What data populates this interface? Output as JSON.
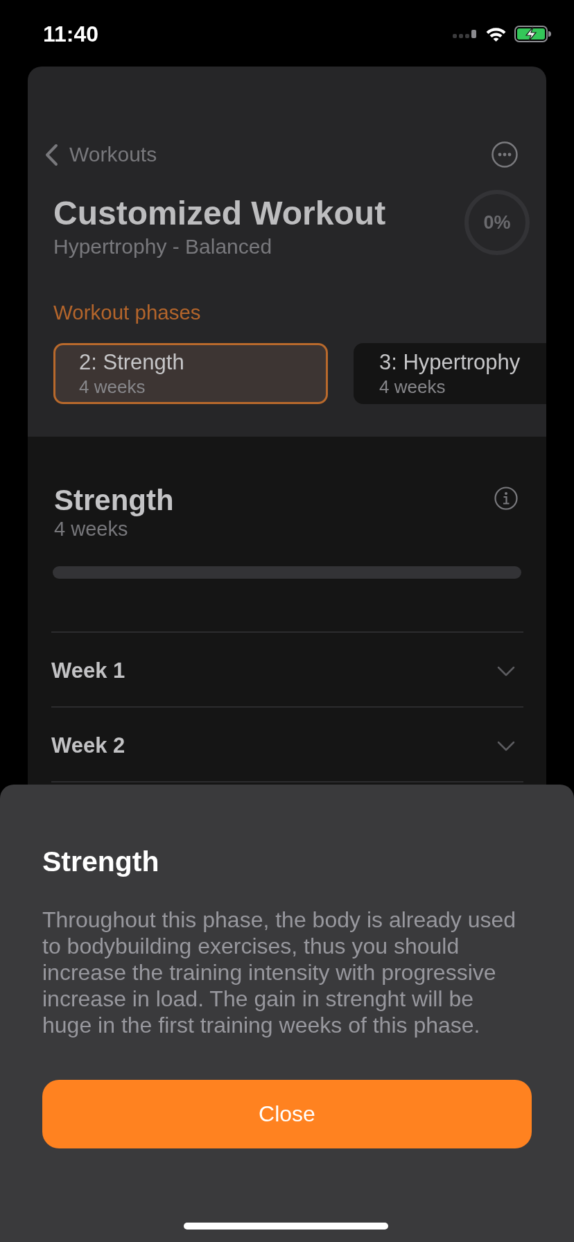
{
  "status_bar": {
    "time": "11:40"
  },
  "navigation": {
    "back_label": "Workouts"
  },
  "workout": {
    "title": "Customized Workout",
    "subtitle": "Hypertrophy - Balanced",
    "progress": "0%"
  },
  "phases": {
    "heading": "Workout phases",
    "items": [
      {
        "name": "2: Strength",
        "duration": "4 weeks",
        "selected": true
      },
      {
        "name": "3: Hypertrophy",
        "duration": "4 weeks",
        "selected": false
      }
    ]
  },
  "phase_detail": {
    "title": "Strength",
    "duration": "4 weeks",
    "level": 0
  },
  "weeks": [
    {
      "label": "Week 1",
      "expanded": false
    },
    {
      "label": "Week 2",
      "expanded": false
    }
  ],
  "sheet": {
    "title": "Strength",
    "body": "Throughout this phase, the body is already used to bodybuilding exercises, thus you should increase the training intensity with progressive increase in load. The gain in strenght will be huge in the first training weeks of this phase.",
    "button": "Close"
  }
}
